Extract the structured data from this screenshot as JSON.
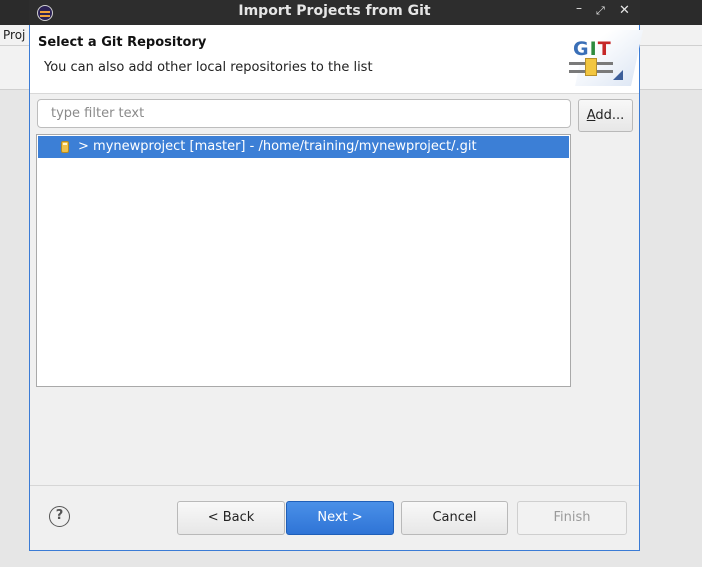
{
  "background": {
    "menu_left": "Proj",
    "menu_right": ""
  },
  "dialog": {
    "title": "Import Projects from Git",
    "window_controls": {
      "minimize": "–",
      "maximize": "⤢",
      "close": "✕"
    },
    "header": {
      "title": "Select a Git Repository",
      "description": "You can also add other local repositories to the list",
      "banner_text": "GIT"
    },
    "filter": {
      "placeholder": "type filter text",
      "value": ""
    },
    "add_button": "Add...",
    "repositories": [
      {
        "label": "> mynewproject [master] - /home/training/mynewproject/.git",
        "selected": true,
        "icon": "git-repository-icon"
      }
    ],
    "help_icon": "?",
    "buttons": {
      "back": "< Back",
      "next": "Next >",
      "cancel": "Cancel",
      "finish": "Finish"
    },
    "colors": {
      "accent": "#3c7fd6",
      "titlebar": "#2d2d2d"
    }
  }
}
